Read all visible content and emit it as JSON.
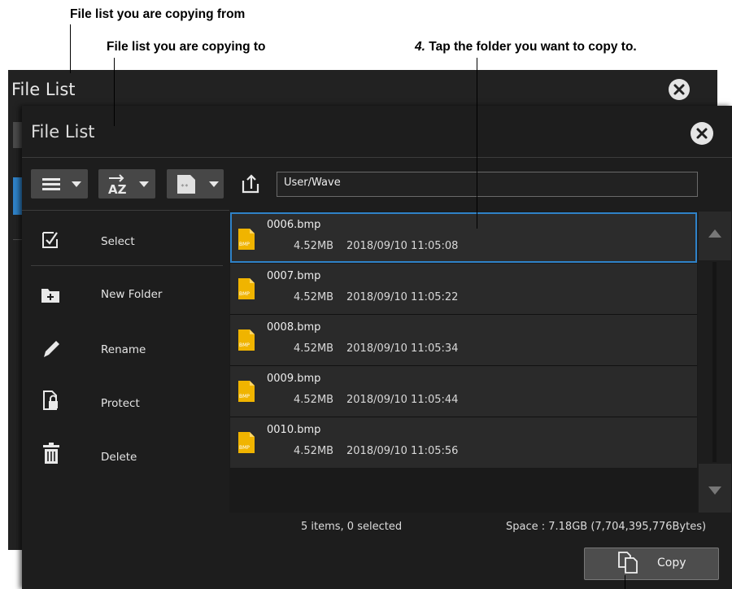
{
  "annotations": {
    "copy_from": "File list you are copying from",
    "copy_to": "File list you are copying to",
    "step_number": "4.",
    "step_text": "Tap the folder you want to copy to."
  },
  "back_window": {
    "title": "File List",
    "close_icon": "close-icon"
  },
  "front_window": {
    "title": "File List",
    "close_icon": "close-icon"
  },
  "toolbar": {
    "view_icon": "list-view-icon",
    "sort_icon": "sort-az-icon",
    "filter_icon": "file-filter-icon",
    "up_icon": "folder-up-icon",
    "path": "User/Wave"
  },
  "menu": [
    {
      "label": "Select",
      "icon": "select-check-icon"
    },
    {
      "label": "New Folder",
      "icon": "new-folder-icon"
    },
    {
      "label": "Rename",
      "icon": "pencil-icon"
    },
    {
      "label": "Protect",
      "icon": "lock-file-icon"
    },
    {
      "label": "Delete",
      "icon": "trash-icon"
    }
  ],
  "files": [
    {
      "name": "0006.bmp",
      "size": "4.52MB",
      "date": "2018/09/10 11:05:08",
      "selected": true
    },
    {
      "name": "0007.bmp",
      "size": "4.52MB",
      "date": "2018/09/10 11:05:22",
      "selected": false
    },
    {
      "name": "0008.bmp",
      "size": "4.52MB",
      "date": "2018/09/10 11:05:34",
      "selected": false
    },
    {
      "name": "0009.bmp",
      "size": "4.52MB",
      "date": "2018/09/10 11:05:44",
      "selected": false
    },
    {
      "name": "0010.bmp",
      "size": "4.52MB",
      "date": "2018/09/10 11:05:56",
      "selected": false
    }
  ],
  "file_icon_text": "BMP",
  "status": {
    "items": "5 items, 0 selected",
    "space": "Space : 7.18GB (7,704,395,776Bytes)"
  },
  "copy_button": {
    "label": "Copy",
    "icon": "copy-icon"
  },
  "colors": {
    "accent": "#2f82c8",
    "window_bg": "#1d1d1d",
    "bmp_icon": "#f0b400"
  }
}
